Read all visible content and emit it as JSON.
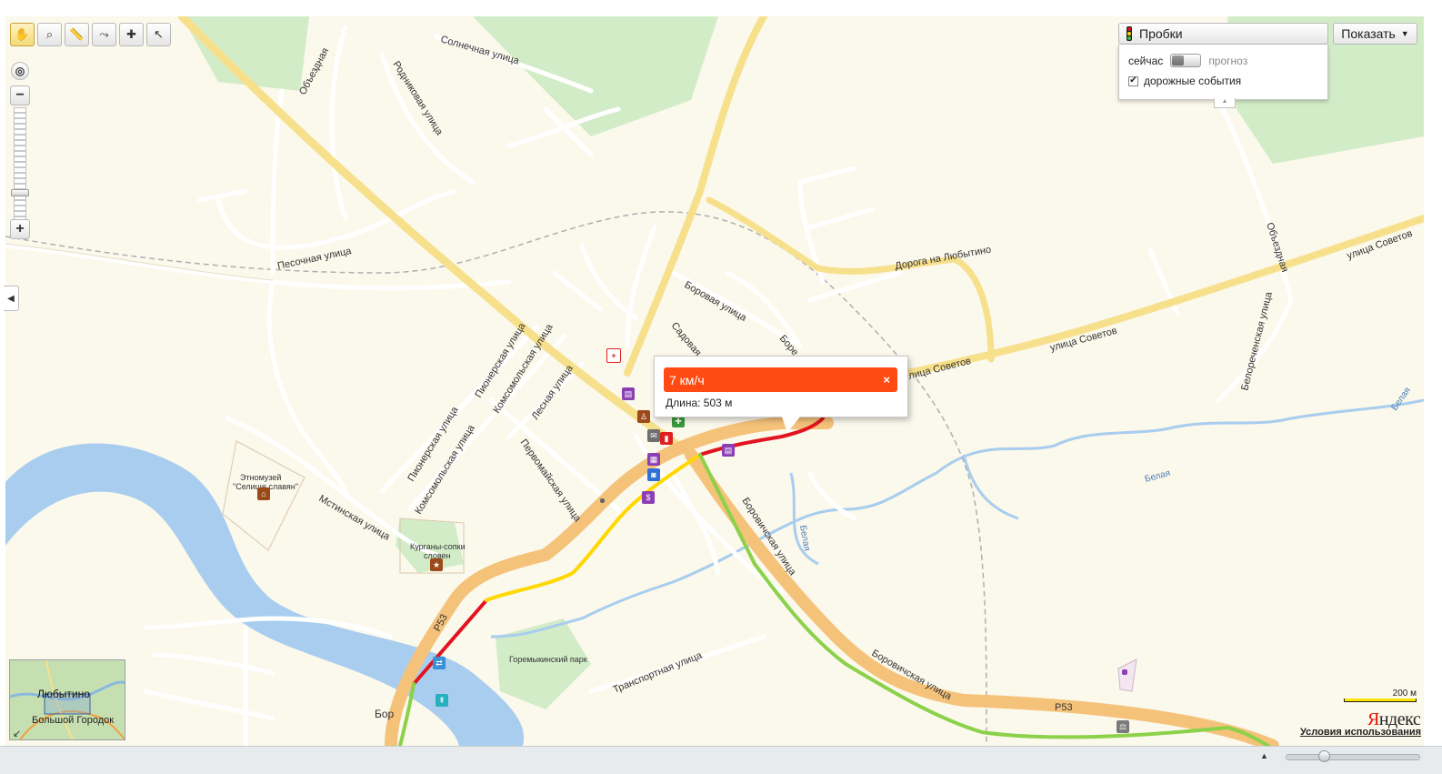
{
  "toolbar": {
    "tools": [
      {
        "name": "hand-tool",
        "icon": "hand-icon",
        "glyph": "✋",
        "active": true
      },
      {
        "name": "zoom-area-tool",
        "icon": "magnifier-icon",
        "glyph": "⌕",
        "active": false
      },
      {
        "name": "ruler-tool",
        "icon": "ruler-icon",
        "glyph": "📏",
        "active": false
      },
      {
        "name": "route-tool",
        "icon": "route-icon",
        "glyph": "⤳",
        "active": false
      },
      {
        "name": "add-tool",
        "icon": "add-object-icon",
        "glyph": "✚",
        "active": false
      },
      {
        "name": "info-tool",
        "icon": "cursor-question-icon",
        "glyph": "↖",
        "active": false
      }
    ]
  },
  "zoom": {
    "minus": "−",
    "plus": "+",
    "level_fraction": 0.72
  },
  "traffic": {
    "title": "Пробки",
    "now_label": "сейчас",
    "forecast_label": "прогноз",
    "events_checked": true,
    "events_label": "дорожные события",
    "check_glyph": "✔"
  },
  "show_button": {
    "label": "Показать",
    "arrow": "▼"
  },
  "popup": {
    "speed": "7 км/ч",
    "close": "×",
    "length": "Длина: 503 м",
    "header_color": "#ff4b13"
  },
  "map_labels": {
    "solnechnaya": "Солнечная улица",
    "obezdnaya1": "Объездная",
    "rodnikovaya": "Родниковая улица",
    "pesochnaya": "Песочная улица",
    "doroga": "Дорога на Любытино",
    "borovaya": "Боровая улица",
    "sadovaya": "Садовая",
    "bore": "Боре",
    "sovetov1": "улица Советов",
    "sovetov2": "улица Советов",
    "sovetov3": "улица Советов",
    "obezdnaya2": "Объездная",
    "belorech": "Белореченская улица",
    "pionerskaya1": "Пионерская улица",
    "komsomol1": "Комсомольская улица",
    "lesnaya": "Лесная улица",
    "pionerskaya2": "Пионерская улица",
    "komsomol2": "Комсомольская улица",
    "pervomai": "Первомайская улица",
    "etno1": "Этномузей",
    "etno2": "\"Селище славян\"",
    "mstinskaya": "Мстинская улица",
    "kurgany1": "Курганы-сопки",
    "kurgany2": "словен",
    "borovich1": "Боровичская улица",
    "borovich2": "Боровичская улица",
    "belaya1": "Белая",
    "belaya2": "Белая",
    "belaya3": "Белая",
    "p53a": "Р53",
    "p53b": "Р53",
    "goremyk": "Горемыкинский парк",
    "transport": "Транспортная улица",
    "bor": "Бор"
  },
  "minimap": {
    "city": "Любытино",
    "town": "Большой Городок",
    "toggle": "↙"
  },
  "scale": {
    "label": "200 м"
  },
  "logo": {
    "first": "Я",
    "rest": "ндекс"
  },
  "terms": "Условия использования",
  "bottom": {
    "up_arrow": "▲"
  },
  "colors": {
    "road_main": "#f5c27a",
    "road_yellow": "#f7e08c",
    "traffic_red": "#e2141f",
    "traffic_yellow": "#ffd800",
    "traffic_green": "#8cd14a",
    "water": "#a8cdee",
    "park": "#d3ecc8"
  }
}
